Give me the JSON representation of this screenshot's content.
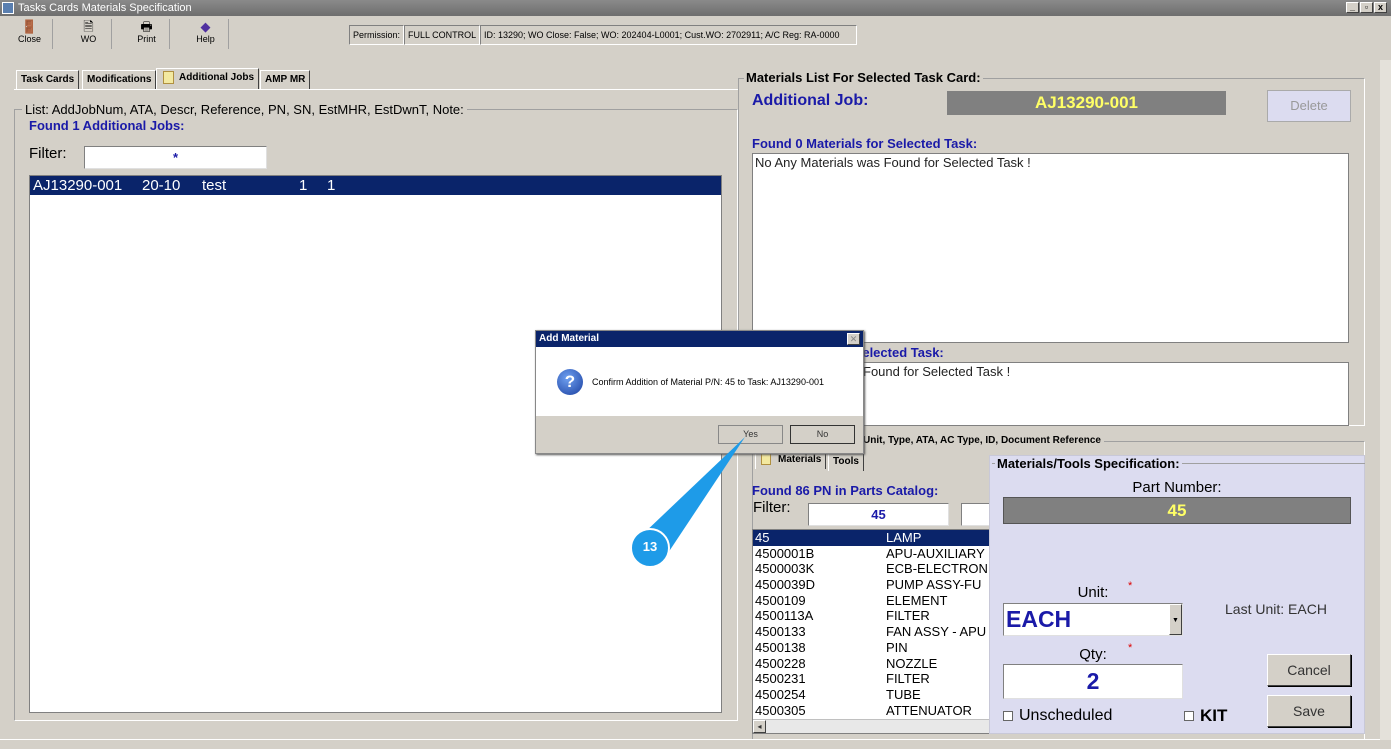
{
  "window": {
    "title": "Tasks Cards Materials Specification",
    "controls": [
      "_",
      "▫",
      "x"
    ]
  },
  "toolbar": {
    "close": "Close",
    "wo": "WO",
    "print": "Print",
    "help": "Help",
    "permission_label": "Permission:",
    "permission_value": "FULL CONTROL",
    "info": "ID: 13290; WO Close: False; WO: 202404-L0001; Cust.WO: 2702911; A/C Reg: RA-0000"
  },
  "tabs": [
    "Task Cards",
    "Modifications",
    "Additional Jobs",
    "AMP MR"
  ],
  "left": {
    "group_title": "List: AddJobNum, ATA, Descr, Reference, PN, SN, EstMHR, EstDwnT, Note:",
    "found": "Found 1 Additional Jobs:",
    "filter_label": "Filter:",
    "filter_value": "*",
    "rows": [
      {
        "num": "AJ13290-001",
        "ata": "20-10",
        "descr": "test",
        "mhr": "1",
        "dwn": "1"
      }
    ]
  },
  "right": {
    "group_title": "Materials List For Selected Task Card:",
    "job_label": "Additional Job:",
    "job_value": "AJ13290-001",
    "delete": "Delete",
    "materials_found": "Found 0 Materials for Selected Task:",
    "materials_text": "No Any Materials was Found for Selected Task !",
    "tools_found_partial": "r Selected Task:",
    "tools_text_partial": "Found for Selected Task !"
  },
  "catalog": {
    "group_title": "Unit, Type, ATA, AC Type, ID, Document Reference",
    "tabs": [
      "Materials",
      "Tools"
    ],
    "found": "Found 86 PN in Parts Catalog:",
    "filter_label": "Filter:",
    "filter_value": "45",
    "rows": [
      {
        "pn": "45",
        "d": "LAMP"
      },
      {
        "pn": "4500001B",
        "d": "APU-AUXILIARY"
      },
      {
        "pn": "4500003K",
        "d": "ECB-ELECTRON"
      },
      {
        "pn": "4500039D",
        "d": "PUMP ASSY-FU"
      },
      {
        "pn": "4500109",
        "d": "ELEMENT"
      },
      {
        "pn": "4500113A",
        "d": "FILTER"
      },
      {
        "pn": "4500133",
        "d": "FAN ASSY - APU"
      },
      {
        "pn": "4500138",
        "d": "PIN"
      },
      {
        "pn": "4500228",
        "d": "NOZZLE"
      },
      {
        "pn": "4500231",
        "d": "FILTER"
      },
      {
        "pn": "4500254",
        "d": "TUBE"
      },
      {
        "pn": "4500305",
        "d": "ATTENUATOR"
      }
    ]
  },
  "spec": {
    "title": "Materials/Tools Specification:",
    "pn_label": "Part Number:",
    "pn_value": "45",
    "unit_label": "Unit:",
    "unit_value": "EACH",
    "last_unit": "Last Unit: EACH",
    "qty_label": "Qty:",
    "qty_value": "2",
    "required": "*",
    "cancel": "Cancel",
    "save": "Save",
    "unscheduled": "Unscheduled",
    "kit": "KIT"
  },
  "dialog": {
    "title": "Add Material",
    "message": "Confirm Addition of Material P/N: 45 to Task: AJ13290-001",
    "yes": "Yes",
    "no": "No"
  },
  "callout": {
    "step": "13",
    "color": "#1e9be8"
  }
}
